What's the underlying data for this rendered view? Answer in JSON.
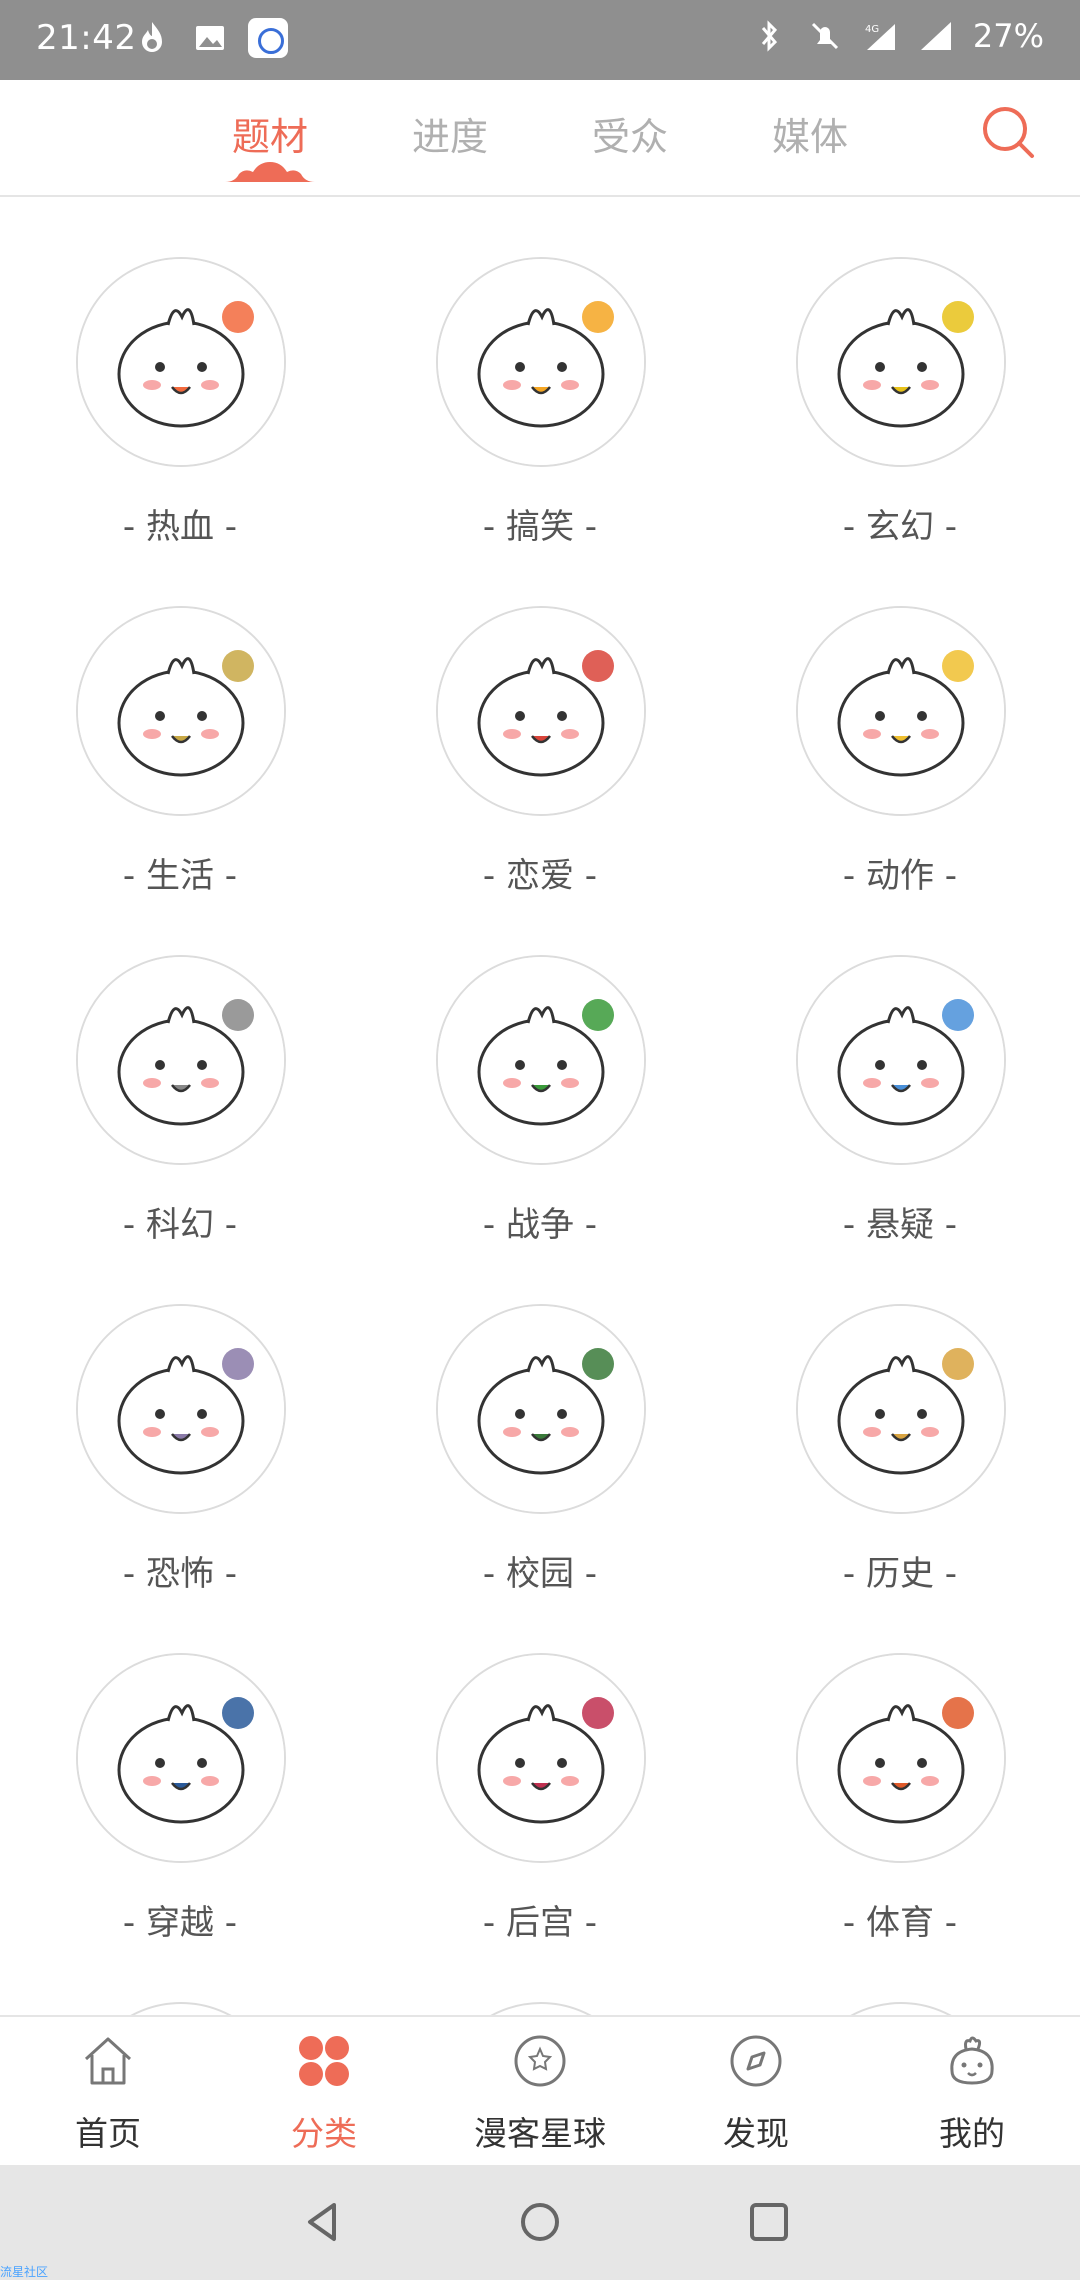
{
  "status_bar": {
    "time": "21:42",
    "battery": "27%",
    "network": "4G",
    "icons": [
      "flame-icon",
      "image-icon",
      "app-icon",
      "bluetooth-icon",
      "mute-icon",
      "signal-icon",
      "battery-icon"
    ]
  },
  "top_tabs": [
    {
      "label": "题材",
      "active": true
    },
    {
      "label": "进度",
      "active": false
    },
    {
      "label": "受众",
      "active": false
    },
    {
      "label": "媒体",
      "active": false
    }
  ],
  "colors": {
    "accent": "#ee6c57",
    "inactive": "#b0b0b0",
    "status_bar": "#8f8f8f"
  },
  "categories": [
    {
      "label": "- 热血 -",
      "icon": "hot-blood-icon"
    },
    {
      "label": "- 搞笑 -",
      "icon": "funny-icon"
    },
    {
      "label": "- 玄幻 -",
      "icon": "fantasy-icon"
    },
    {
      "label": "- 生活 -",
      "icon": "life-icon"
    },
    {
      "label": "- 恋爱 -",
      "icon": "romance-icon"
    },
    {
      "label": "- 动作 -",
      "icon": "action-icon"
    },
    {
      "label": "- 科幻 -",
      "icon": "scifi-icon"
    },
    {
      "label": "- 战争 -",
      "icon": "war-icon"
    },
    {
      "label": "- 悬疑 -",
      "icon": "mystery-icon"
    },
    {
      "label": "- 恐怖 -",
      "icon": "horror-icon"
    },
    {
      "label": "- 校园 -",
      "icon": "campus-icon"
    },
    {
      "label": "- 历史 -",
      "icon": "history-icon"
    },
    {
      "label": "- 穿越 -",
      "icon": "time-travel-icon"
    },
    {
      "label": "- 后宫 -",
      "icon": "harem-icon"
    },
    {
      "label": "- 体育 -",
      "icon": "sports-icon"
    }
  ],
  "bottom_nav": [
    {
      "label": "首页",
      "icon": "home-icon",
      "active": false
    },
    {
      "label": "分类",
      "icon": "category-icon",
      "active": true
    },
    {
      "label": "漫客星球",
      "icon": "planet-icon",
      "active": false
    },
    {
      "label": "发现",
      "icon": "compass-icon",
      "active": false
    },
    {
      "label": "我的",
      "icon": "profile-icon",
      "active": false
    }
  ],
  "watermark": "流星社区"
}
